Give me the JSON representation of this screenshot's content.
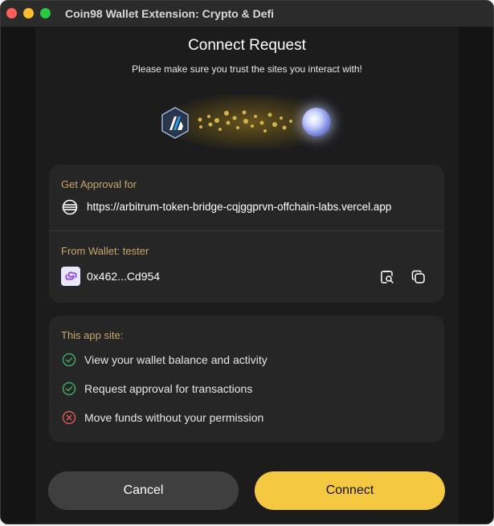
{
  "window": {
    "title": "Coin98 Wallet Extension: Crypto & Defi"
  },
  "header": {
    "title": "Connect Request",
    "subtitle": "Please make sure you trust the sites you interact with!"
  },
  "hero": {
    "left_icon": "arbitrum-logo-icon",
    "right_icon": "globe-icon"
  },
  "approval": {
    "label": "Get Approval for",
    "site_url": "https://arbitrum-token-bridge-cqjggprvn-offchain-labs.vercel.app",
    "site_icon": "globe-outline-icon"
  },
  "wallet": {
    "label": "From Wallet: tester",
    "address": "0x462...Cd954",
    "chain_icon": "polygon-icon",
    "actions": [
      "explorer-search-icon",
      "copy-icon"
    ]
  },
  "permissions": {
    "label": "This app site:",
    "items": [
      {
        "text": "View your wallet balance and activity",
        "allowed": true
      },
      {
        "text": "Request approval for transactions",
        "allowed": true
      },
      {
        "text": "Move funds without your permission",
        "allowed": false
      }
    ]
  },
  "buttons": {
    "cancel": "Cancel",
    "connect": "Connect"
  },
  "colors": {
    "accent": "#f5c842",
    "allowed": "#3fae6a",
    "denied": "#e05a5a",
    "label": "#c9a66b"
  }
}
